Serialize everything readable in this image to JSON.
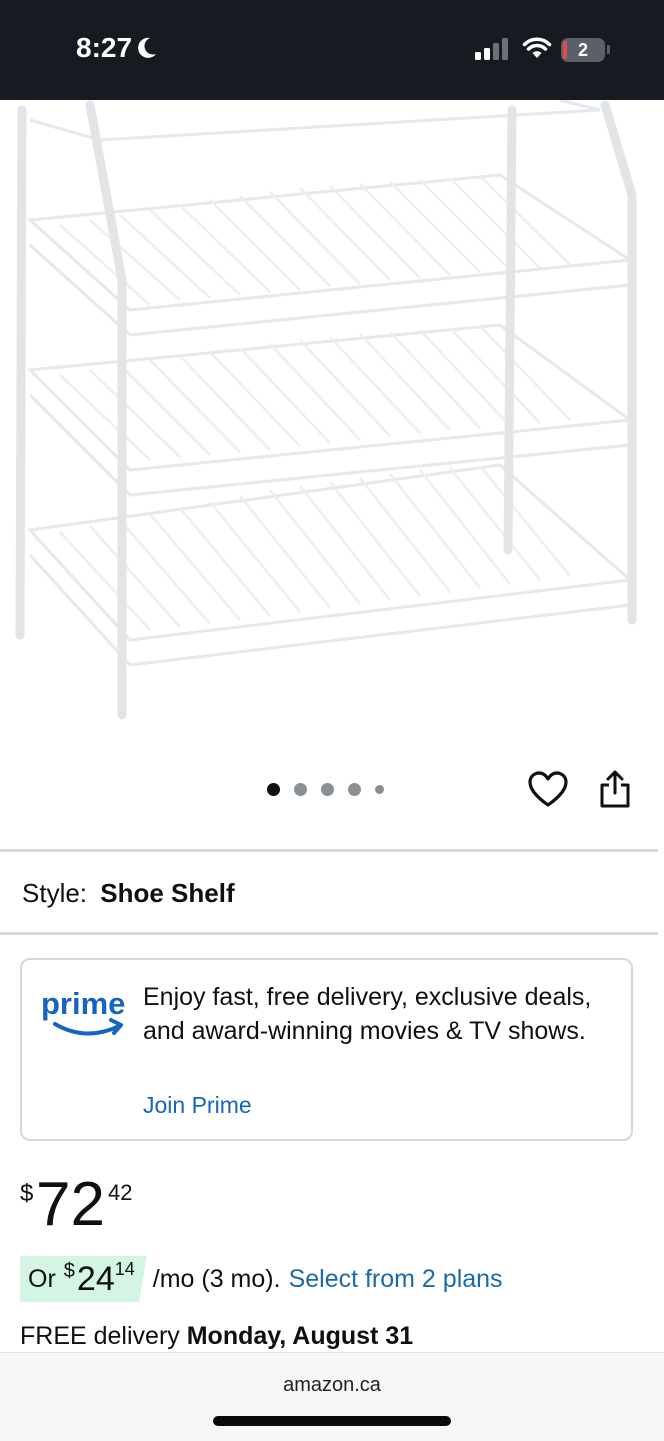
{
  "status_bar": {
    "time": "8:27",
    "battery": "2"
  },
  "carousel": {
    "count": 5,
    "active_index": 0
  },
  "style": {
    "label": "Style:",
    "value": "Shoe Shelf"
  },
  "prime": {
    "logo_text": "prime",
    "description": "Enjoy fast, free delivery, exclusive deals, and award-winning movies & TV shows.",
    "link": "Join Prime"
  },
  "price": {
    "symbol": "$",
    "whole": "72",
    "fraction": "42"
  },
  "installment": {
    "prefix": "Or",
    "symbol": "$",
    "whole": "24",
    "fraction": "14",
    "term": "/mo (3 mo).",
    "link": "Select from 2 plans"
  },
  "delivery": {
    "prefix": "FREE delivery",
    "date": "Monday, August 31"
  },
  "browser": {
    "url": "amazon.ca"
  },
  "colors": {
    "link": "#1a6ba8",
    "prime_blue": "#1565c0",
    "badge_bg": "#d4f5e3",
    "status_bg": "#161b22"
  }
}
